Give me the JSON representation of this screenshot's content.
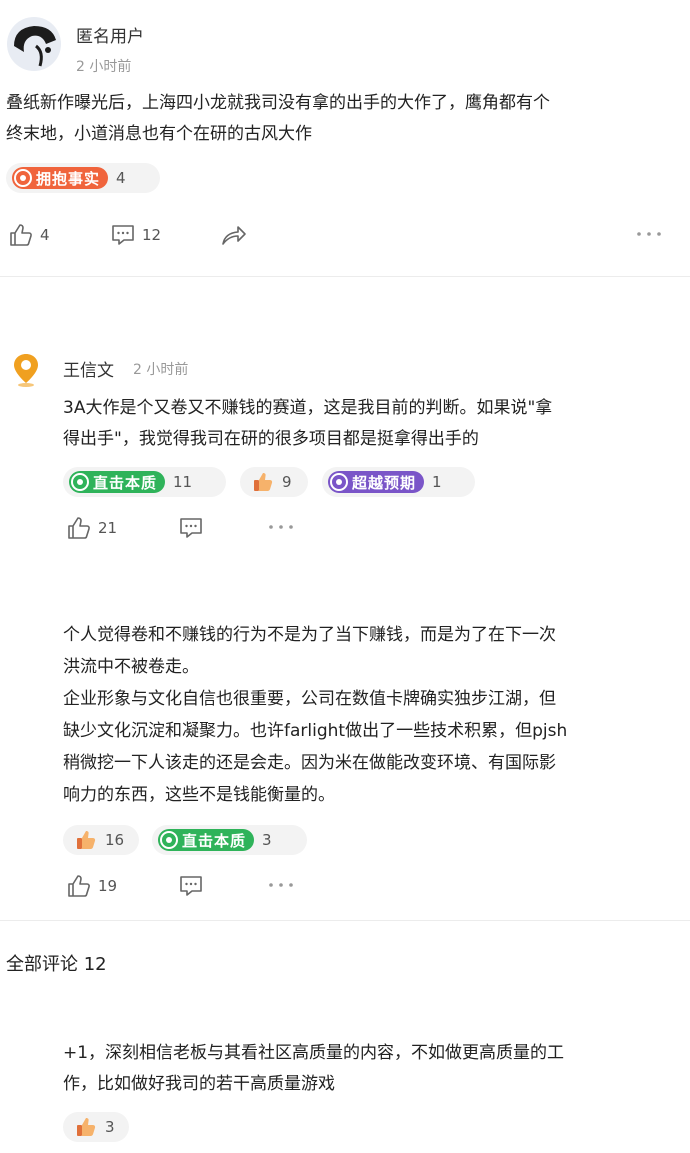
{
  "post1": {
    "user": "匿名用户",
    "time": "2 小时前",
    "text_l1": "叠纸新作曝光后，上海四小龙就我司没有拿的出手的大作了，鹰角都有个",
    "text_l2": "终末地，小道消息也有个在研的古风大作",
    "badge": {
      "label": "拥抱事实",
      "count": "4",
      "color": "#f0643c"
    },
    "likes": "4",
    "comments": "12"
  },
  "comment1": {
    "user": "王信文",
    "time": "2 小时前",
    "text_l1": "3A大作是个又卷又不赚钱的赛道，这是我目前的判断。如果说\"拿",
    "text_l2": "得出手\"，我觉得我司在研的很多项目都是挺拿得出手的",
    "reactions": [
      {
        "label": "直击本质",
        "count": "11",
        "color": "#2fb35a"
      },
      {
        "label": "",
        "count": "9"
      },
      {
        "label": "超越预期",
        "count": "1",
        "color": "#7a55c8"
      }
    ],
    "likes": "21"
  },
  "comment2": {
    "lines": [
      "个人觉得卷和不赚钱的行为不是为了当下赚钱，而是为了在下一次",
      "洪流中不被卷走。",
      "企业形象与文化自信也很重要，公司在数值卡牌确实独步江湖，但",
      "缺少文化沉淀和凝聚力。也许farlight做出了一些技术积累，但pjsh",
      "稍微挖一下人该走的还是会走。因为米在做能改变环境、有国际影",
      "响力的东西，这些不是钱能衡量的。"
    ],
    "reactions": [
      {
        "count": "16"
      },
      {
        "label": "直击本质",
        "count": "3",
        "color": "#2fb35a"
      }
    ],
    "likes": "19"
  },
  "all_comments": {
    "label": "全部评论 12"
  },
  "comment3": {
    "text_l1": "+1，深刻相信老板与其看社区高质量的内容，不如做更高质量的工",
    "text_l2": "作，比如做好我司的若干高质量游戏",
    "reaction_count": "3"
  },
  "icons": [
    "avatar-icon",
    "location-pin-avatar-icon",
    "like-icon",
    "comment-icon",
    "share-icon",
    "more-icon",
    "thumbs-up-emoji-icon"
  ]
}
